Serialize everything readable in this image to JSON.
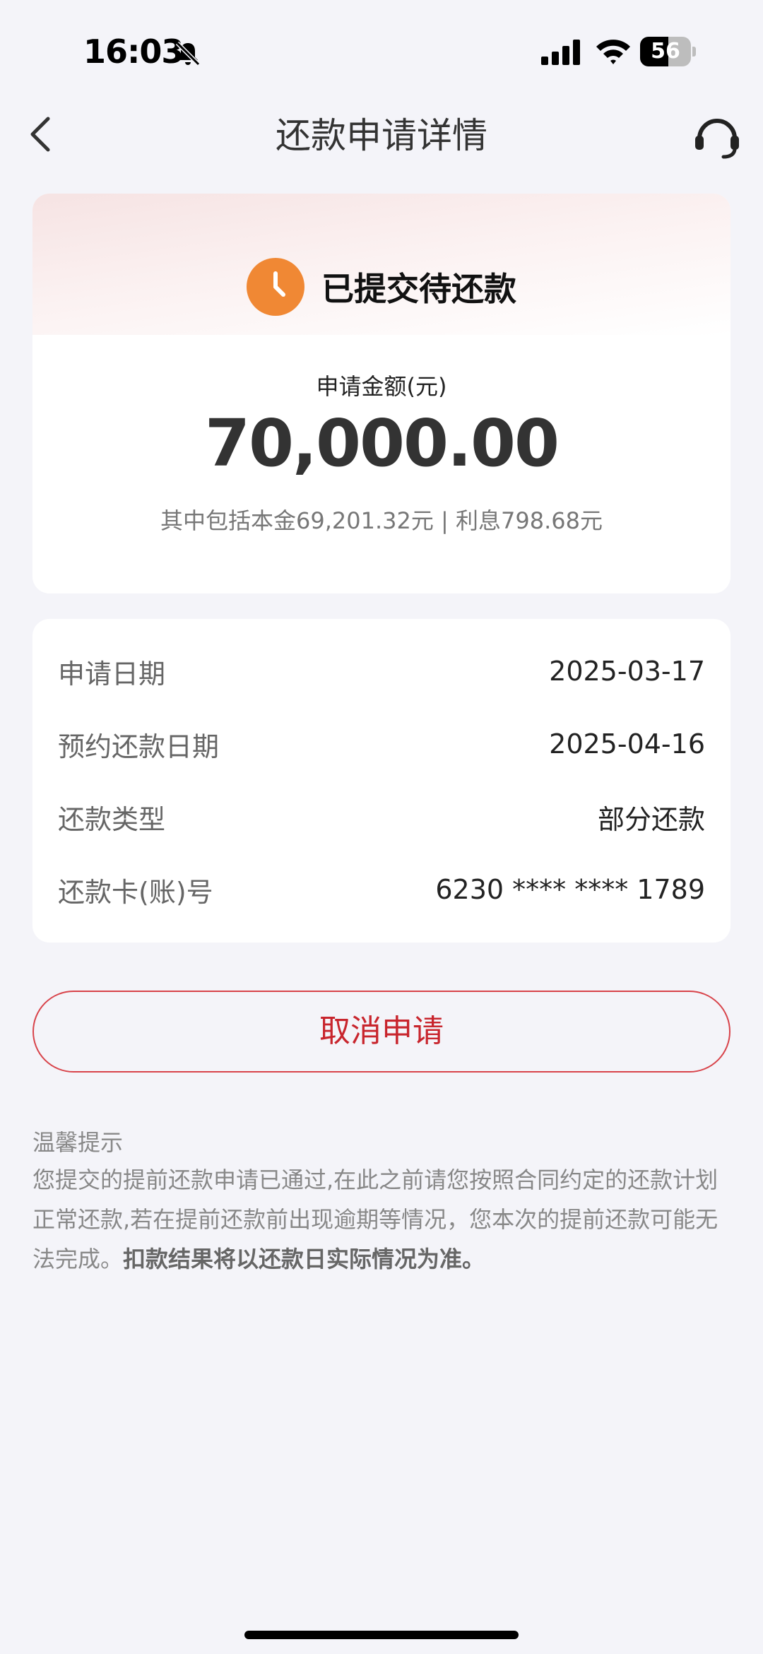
{
  "status_bar": {
    "time": "16:03",
    "battery_level": "56",
    "battery_fraction": 0.56,
    "icons": [
      "bell-off-icon",
      "cellular-signal-icon",
      "wifi-icon",
      "battery-icon"
    ]
  },
  "nav": {
    "title": "还款申请详情",
    "back_icon": "chevron-left-icon",
    "service_icon": "headset-icon"
  },
  "status_card": {
    "status_text": "已提交待还款",
    "status_icon": "clock-icon",
    "status_color": "#f08834",
    "amount_label": "申请金额(元)",
    "amount": "70,000.00",
    "breakdown": "其中包括本金69,201.32元 | 利息798.68元"
  },
  "details": [
    {
      "label": "申请日期",
      "value": "2025-03-17"
    },
    {
      "label": "预约还款日期",
      "value": "2025-04-16"
    },
    {
      "label": "还款类型",
      "value": "部分还款"
    },
    {
      "label": "还款卡(账)号",
      "value": "6230 **** **** 1789"
    }
  ],
  "actions": {
    "cancel_label": "取消申请",
    "accent_color": "#c8252d"
  },
  "tips": {
    "title": "温馨提示",
    "body": "您提交的提前还款申请已通过,在此之前请您按照合同约定的还款计划正常还款,若在提前还款前出现逾期等情况，您本次的提前还款可能无法完成。",
    "body_bold": "扣款结果将以还款日实际情况为准。"
  }
}
